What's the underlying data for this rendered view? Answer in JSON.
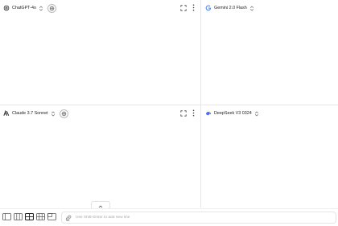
{
  "panes": [
    {
      "model": "ChatGPT-4o",
      "logo_icon": "openai-logo-icon",
      "has_globe": true
    },
    {
      "model": "Gemini 2.0 Flash",
      "logo_icon": "google-logo-icon",
      "has_globe": false
    },
    {
      "model": "Claude 3.7 Sonnet",
      "logo_icon": "anthropic-logo-icon",
      "has_globe": true
    },
    {
      "model": "DeepSeek V3 0324",
      "logo_icon": "deepseek-logo-icon",
      "has_globe": false
    }
  ],
  "input": {
    "placeholder": "Use Shift+Enter to add new line"
  },
  "colors": {
    "border": "#e6e6e6",
    "icon": "#555555",
    "google_blue": "#4285f4",
    "deepseek_blue": "#4d6bfe",
    "active_layout": "#222222"
  },
  "layouts": [
    "single-layout",
    "two-columns-layout",
    "four-grid-layout",
    "six-grid-layout",
    "picture-in-picture-layout"
  ],
  "active_layout": "four-grid-layout"
}
